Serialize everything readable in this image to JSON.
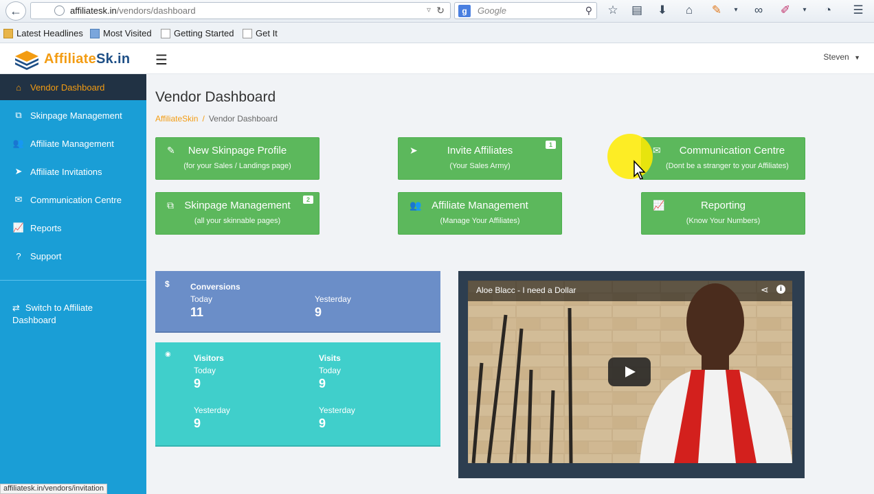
{
  "browser": {
    "url_host": "affiliatesk.in",
    "url_path": "/vendors/dashboard",
    "search_placeholder": "Google",
    "search_engine_letter": "g",
    "status_url": "affiliatesk.in/vendors/invitation"
  },
  "bookmarks": [
    {
      "label": "Latest Headlines",
      "icon": "rss-folder-icon"
    },
    {
      "label": "Most Visited",
      "icon": "most-visited-icon"
    },
    {
      "label": "Getting Started",
      "icon": "page-icon"
    },
    {
      "label": "Get It",
      "icon": "page-icon"
    }
  ],
  "header": {
    "logo_part1": "Affiliate",
    "logo_part2": "Sk.in",
    "user_name": "Steven"
  },
  "sidebar": {
    "items": [
      {
        "label": "Vendor Dashboard",
        "icon": "home-icon",
        "glyph": "⌂",
        "active": true
      },
      {
        "label": "Skinpage Management",
        "icon": "copy-icon",
        "glyph": "⧉"
      },
      {
        "label": "Affiliate Management",
        "icon": "users-icon",
        "glyph": "👥"
      },
      {
        "label": "Affiliate Invitations",
        "icon": "send-icon",
        "glyph": "➤"
      },
      {
        "label": "Communication Centre",
        "icon": "envelope-icon",
        "glyph": "✉"
      },
      {
        "label": "Reports",
        "icon": "chart-icon",
        "glyph": "📈"
      },
      {
        "label": "Support",
        "icon": "question-icon",
        "glyph": "?"
      }
    ],
    "switch_label": "Switch to Affiliate Dashboard"
  },
  "page": {
    "title": "Vendor Dashboard",
    "breadcrumb_home": "AffiliateSkin",
    "breadcrumb_sep": "/",
    "breadcrumb_current": "Vendor Dashboard"
  },
  "actions": [
    {
      "title": "New Skinpage Profile",
      "sub": "(for your Sales / Landings page)",
      "icon": "edit-icon",
      "glyph": "✎",
      "badge": ""
    },
    {
      "title": "Invite Affiliates",
      "sub": "(Your Sales Army)",
      "icon": "send-icon",
      "glyph": "➤",
      "badge": "1"
    },
    {
      "title": "Communication Centre",
      "sub": "(Dont be a stranger to your Affiliates)",
      "icon": "envelope-icon",
      "glyph": "✉",
      "badge": ""
    },
    {
      "title": "Skinpage Management",
      "sub": "(all your skinnable pages)",
      "icon": "copy-icon",
      "glyph": "⧉",
      "badge": "2"
    },
    {
      "title": "Affiliate Management",
      "sub": "(Manage Your Affiliates)",
      "icon": "users-icon",
      "glyph": "👥",
      "badge": ""
    },
    {
      "title": "Reporting",
      "sub": "(Know Your Numbers)",
      "icon": "chart-icon",
      "glyph": "📈",
      "badge": ""
    }
  ],
  "conversions": {
    "icon": "dollar-icon",
    "glyph": "$",
    "label": "Conversions",
    "today_label": "Today",
    "today_value": "11",
    "yesterday_label": "Yesterday",
    "yesterday_value": "9",
    "color": "#6b8ec8"
  },
  "traffic": {
    "icon": "eye-icon",
    "glyph": "◉",
    "visitors_label": "Visitors",
    "visits_label": "Visits",
    "today_label": "Today",
    "yesterday_label": "Yesterday",
    "visitors_today": "9",
    "visitors_yesterday": "9",
    "visits_today": "9",
    "visits_yesterday": "9",
    "color": "#40cfcb"
  },
  "video": {
    "title": "Aloe Blacc - I need a Dollar"
  },
  "colors": {
    "sidebar": "#1a9ed6",
    "accent": "#f39c12",
    "action_green": "#5cb85c"
  }
}
